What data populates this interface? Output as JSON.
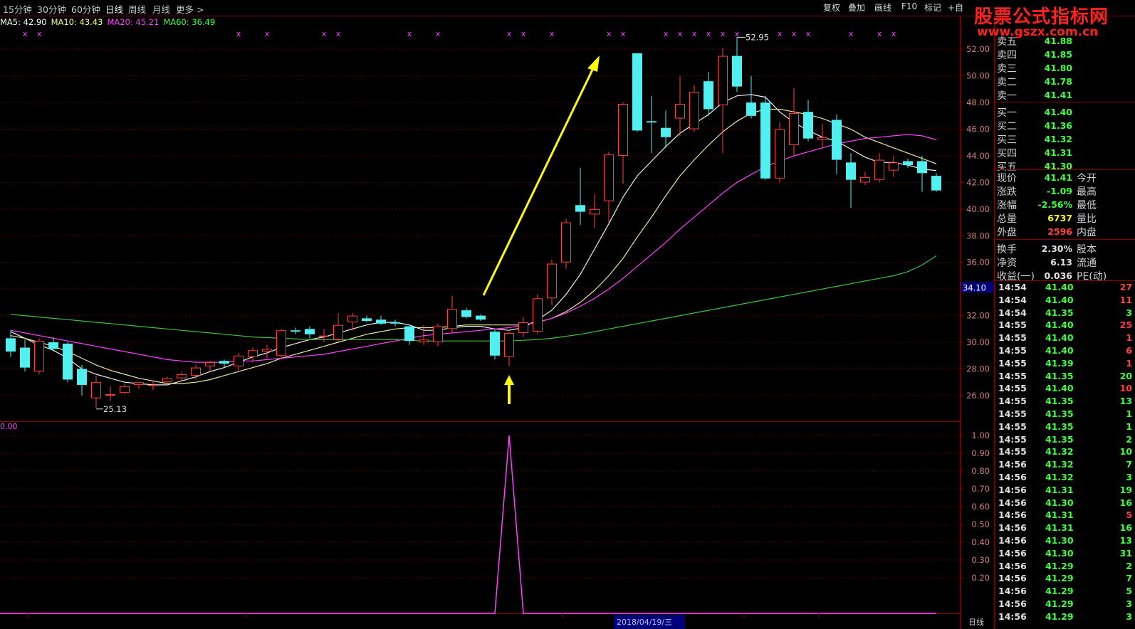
{
  "toolbar": {
    "periods": [
      "15分钟",
      "30分钟",
      "60分钟",
      "日线",
      "周线",
      "月线",
      "更多 >"
    ],
    "active_period": "日线",
    "buttons": [
      "复权",
      "叠加",
      "画线",
      "F10",
      "标记",
      "+自"
    ]
  },
  "watermark": {
    "line1": "股票公式指标网",
    "line2": "www.gszx.com.cn"
  },
  "ma_legend": [
    {
      "label": "MA5: 42.90",
      "color": "#ffffff"
    },
    {
      "label": "MA10: 43.43",
      "color": "#ffff80"
    },
    {
      "label": "MA20: 45.21",
      "color": "#ff40ff"
    },
    {
      "label": "MA60: 36.49",
      "color": "#40ff40"
    }
  ],
  "colors": {
    "up": "#ff4040",
    "down": "#50f0f0",
    "grid": "#8b0000",
    "axis_text": "#d08080",
    "green": "#40ff40",
    "red": "#ff4040",
    "yellow": "#ffff00"
  },
  "annotations": {
    "high_label": "52.95",
    "low_label": "25.13",
    "current_tag": "34.10",
    "indicator_top": "0.00",
    "date_label": "2018/04/19/三",
    "period_label": "日线"
  },
  "price_axis": {
    "ticks": [
      "52.00",
      "50.00",
      "48.00",
      "46.00",
      "44.00",
      "42.00",
      "40.00",
      "38.00",
      "36.00",
      "34.00",
      "32.00",
      "30.00",
      "28.00",
      "26.00"
    ]
  },
  "indicator_axis": {
    "ticks": [
      "1.00",
      "0.90",
      "0.80",
      "0.70",
      "0.60",
      "0.50",
      "0.40",
      "0.30",
      "0.20"
    ]
  },
  "order_book": {
    "sells": [
      {
        "label": "卖五",
        "price": "41.88"
      },
      {
        "label": "卖四",
        "price": "41.85"
      },
      {
        "label": "卖三",
        "price": "41.80"
      },
      {
        "label": "卖二",
        "price": "41.78"
      },
      {
        "label": "卖一",
        "price": "41.41"
      }
    ],
    "buys": [
      {
        "label": "买一",
        "price": "41.40"
      },
      {
        "label": "买二",
        "price": "41.36"
      },
      {
        "label": "买三",
        "price": "41.32"
      },
      {
        "label": "买四",
        "price": "41.31"
      },
      {
        "label": "买五",
        "price": "41.30"
      }
    ]
  },
  "quote": [
    {
      "label": "现价",
      "value": "41.41",
      "value_color": "#40ff40",
      "label2": "今开"
    },
    {
      "label": "涨跌",
      "value": "-1.09",
      "value_color": "#40ff40",
      "label2": "最高"
    },
    {
      "label": "涨幅",
      "value": "-2.56%",
      "value_color": "#40ff40",
      "label2": "最低"
    },
    {
      "label": "总量",
      "value": "6737",
      "value_color": "#ffff00",
      "label2": "量比"
    },
    {
      "label": "外盘",
      "value": "2596",
      "value_color": "#ff4040",
      "label2": "内盘"
    },
    {
      "label": "换手",
      "value": "2.30%",
      "value_color": "#e0e0e0",
      "label2": "股本"
    },
    {
      "label": "净资",
      "value": "6.13",
      "value_color": "#e0e0e0",
      "label2": "流通"
    },
    {
      "label": "收益(一)",
      "value": "0.036",
      "value_color": "#e0e0e0",
      "label2": "PE(动)"
    }
  ],
  "ticks": [
    {
      "time": "14:54",
      "price": "41.40",
      "vol": "27",
      "vcolor": "#ff4040"
    },
    {
      "time": "14:54",
      "price": "41.40",
      "vol": "11",
      "vcolor": "#ff4040"
    },
    {
      "time": "14:54",
      "price": "41.35",
      "vol": "3",
      "vcolor": "#40ff40"
    },
    {
      "time": "14:55",
      "price": "41.40",
      "vol": "25",
      "vcolor": "#ff4040"
    },
    {
      "time": "14:55",
      "price": "41.40",
      "vol": "1",
      "vcolor": "#ff4040"
    },
    {
      "time": "14:55",
      "price": "41.40",
      "vol": "6",
      "vcolor": "#ff4040"
    },
    {
      "time": "14:55",
      "price": "41.39",
      "vol": "1",
      "vcolor": "#ff4040"
    },
    {
      "time": "14:55",
      "price": "41.35",
      "vol": "20",
      "vcolor": "#40ff40"
    },
    {
      "time": "14:55",
      "price": "41.40",
      "vol": "10",
      "vcolor": "#ff4040"
    },
    {
      "time": "14:55",
      "price": "41.35",
      "vol": "13",
      "vcolor": "#40ff40"
    },
    {
      "time": "14:55",
      "price": "41.35",
      "vol": "1",
      "vcolor": "#40ff40"
    },
    {
      "time": "14:55",
      "price": "41.35",
      "vol": "1",
      "vcolor": "#40ff40"
    },
    {
      "time": "14:55",
      "price": "41.35",
      "vol": "2",
      "vcolor": "#40ff40"
    },
    {
      "time": "14:55",
      "price": "41.32",
      "vol": "10",
      "vcolor": "#40ff40"
    },
    {
      "time": "14:56",
      "price": "41.32",
      "vol": "7",
      "vcolor": "#40ff40"
    },
    {
      "time": "14:56",
      "price": "41.32",
      "vol": "3",
      "vcolor": "#40ff40"
    },
    {
      "time": "14:56",
      "price": "41.31",
      "vol": "19",
      "vcolor": "#40ff40"
    },
    {
      "time": "14:56",
      "price": "41.30",
      "vol": "16",
      "vcolor": "#40ff40"
    },
    {
      "time": "14:56",
      "price": "41.31",
      "vol": "5",
      "vcolor": "#ff4040"
    },
    {
      "time": "14:56",
      "price": "41.31",
      "vol": "16",
      "vcolor": "#40ff40"
    },
    {
      "time": "14:56",
      "price": "41.30",
      "vol": "13",
      "vcolor": "#40ff40"
    },
    {
      "time": "14:56",
      "price": "41.30",
      "vol": "31",
      "vcolor": "#40ff40"
    },
    {
      "time": "14:56",
      "price": "41.29",
      "vol": "2",
      "vcolor": "#40ff40"
    },
    {
      "time": "14:56",
      "price": "41.29",
      "vol": "7",
      "vcolor": "#40ff40"
    },
    {
      "time": "14:56",
      "price": "41.29",
      "vol": "5",
      "vcolor": "#40ff40"
    },
    {
      "time": "14:56",
      "price": "41.29",
      "vol": "3",
      "vcolor": "#40ff40"
    },
    {
      "time": "14:56",
      "price": "41.29",
      "vol": "3",
      "vcolor": "#40ff40"
    }
  ],
  "chart_data": {
    "type": "candlestick",
    "price_range": [
      24.5,
      52.6
    ],
    "candles": [
      {
        "o": 30.3,
        "h": 30.9,
        "l": 28.9,
        "c": 29.3
      },
      {
        "o": 29.6,
        "h": 30.2,
        "l": 27.8,
        "c": 28.1
      },
      {
        "o": 27.8,
        "h": 30.3,
        "l": 27.6,
        "c": 30.1
      },
      {
        "o": 30.0,
        "h": 30.4,
        "l": 29.3,
        "c": 29.5
      },
      {
        "o": 29.9,
        "h": 30.0,
        "l": 27.0,
        "c": 27.2
      },
      {
        "o": 28.0,
        "h": 28.3,
        "l": 26.0,
        "c": 26.8
      },
      {
        "o": 25.8,
        "h": 27.5,
        "l": 25.1,
        "c": 27.0
      },
      {
        "o": 26.0,
        "h": 26.7,
        "l": 25.6,
        "c": 26.1
      },
      {
        "o": 26.2,
        "h": 26.9,
        "l": 26.1,
        "c": 26.7
      },
      {
        "o": 26.8,
        "h": 27.0,
        "l": 26.5,
        "c": 27.0
      },
      {
        "o": 26.8,
        "h": 27.1,
        "l": 26.4,
        "c": 26.8
      },
      {
        "o": 27.0,
        "h": 27.4,
        "l": 26.8,
        "c": 27.3
      },
      {
        "o": 27.3,
        "h": 27.8,
        "l": 27.1,
        "c": 27.6
      },
      {
        "o": 27.5,
        "h": 28.3,
        "l": 27.2,
        "c": 28.1
      },
      {
        "o": 28.2,
        "h": 28.6,
        "l": 27.8,
        "c": 28.5
      },
      {
        "o": 28.6,
        "h": 28.7,
        "l": 28.1,
        "c": 28.4
      },
      {
        "o": 28.2,
        "h": 29.2,
        "l": 27.9,
        "c": 29.0
      },
      {
        "o": 28.9,
        "h": 29.6,
        "l": 28.5,
        "c": 29.4
      },
      {
        "o": 29.3,
        "h": 29.8,
        "l": 28.8,
        "c": 29.5
      },
      {
        "o": 29.0,
        "h": 31.0,
        "l": 28.8,
        "c": 30.9
      },
      {
        "o": 30.9,
        "h": 31.1,
        "l": 30.6,
        "c": 30.8
      },
      {
        "o": 31.0,
        "h": 31.2,
        "l": 30.3,
        "c": 30.6
      },
      {
        "o": 30.4,
        "h": 31.0,
        "l": 30.0,
        "c": 30.5
      },
      {
        "o": 30.2,
        "h": 32.2,
        "l": 30.0,
        "c": 31.3
      },
      {
        "o": 31.5,
        "h": 32.2,
        "l": 30.9,
        "c": 32.0
      },
      {
        "o": 31.8,
        "h": 32.0,
        "l": 31.5,
        "c": 31.6
      },
      {
        "o": 31.7,
        "h": 32.0,
        "l": 31.3,
        "c": 31.4
      },
      {
        "o": 31.5,
        "h": 31.7,
        "l": 31.2,
        "c": 31.4
      },
      {
        "o": 31.2,
        "h": 31.3,
        "l": 29.8,
        "c": 30.1
      },
      {
        "o": 30.0,
        "h": 31.3,
        "l": 29.8,
        "c": 30.2
      },
      {
        "o": 30.0,
        "h": 31.4,
        "l": 29.7,
        "c": 31.2
      },
      {
        "o": 31.0,
        "h": 33.5,
        "l": 30.7,
        "c": 32.5
      },
      {
        "o": 32.4,
        "h": 32.6,
        "l": 31.8,
        "c": 31.9
      },
      {
        "o": 32.0,
        "h": 32.1,
        "l": 31.6,
        "c": 31.7
      },
      {
        "o": 30.8,
        "h": 31.0,
        "l": 28.7,
        "c": 29.0
      },
      {
        "o": 28.9,
        "h": 30.8,
        "l": 28.2,
        "c": 30.7
      },
      {
        "o": 30.7,
        "h": 31.9,
        "l": 30.4,
        "c": 31.5
      },
      {
        "o": 30.8,
        "h": 33.6,
        "l": 30.6,
        "c": 33.3
      },
      {
        "o": 33.3,
        "h": 36.2,
        "l": 32.8,
        "c": 35.9
      },
      {
        "o": 36.0,
        "h": 39.3,
        "l": 35.5,
        "c": 39.0
      },
      {
        "o": 40.3,
        "h": 43.1,
        "l": 38.8,
        "c": 39.8
      },
      {
        "o": 39.6,
        "h": 41.1,
        "l": 38.6,
        "c": 40.0
      },
      {
        "o": 40.6,
        "h": 44.3,
        "l": 39.0,
        "c": 44.1
      },
      {
        "o": 44.0,
        "h": 48.0,
        "l": 41.9,
        "c": 47.9
      },
      {
        "o": 51.7,
        "h": 51.7,
        "l": 45.8,
        "c": 45.9
      },
      {
        "o": 46.6,
        "h": 48.5,
        "l": 44.2,
        "c": 46.5
      },
      {
        "o": 46.1,
        "h": 47.4,
        "l": 44.6,
        "c": 45.4
      },
      {
        "o": 46.8,
        "h": 50.0,
        "l": 45.5,
        "c": 47.9
      },
      {
        "o": 46.0,
        "h": 49.3,
        "l": 45.8,
        "c": 48.8
      },
      {
        "o": 49.6,
        "h": 50.3,
        "l": 47.0,
        "c": 47.5
      },
      {
        "o": 47.8,
        "h": 52.1,
        "l": 44.2,
        "c": 51.5
      },
      {
        "o": 51.5,
        "h": 52.9,
        "l": 48.8,
        "c": 49.2
      },
      {
        "o": 48.0,
        "h": 50.0,
        "l": 46.8,
        "c": 47.0
      },
      {
        "o": 48.0,
        "h": 48.5,
        "l": 42.2,
        "c": 42.3
      },
      {
        "o": 42.3,
        "h": 46.5,
        "l": 42.0,
        "c": 46.0
      },
      {
        "o": 44.8,
        "h": 49.1,
        "l": 44.0,
        "c": 47.2
      },
      {
        "o": 47.3,
        "h": 48.2,
        "l": 45.1,
        "c": 45.3
      },
      {
        "o": 45.2,
        "h": 46.4,
        "l": 44.6,
        "c": 45.4
      },
      {
        "o": 46.7,
        "h": 47.1,
        "l": 42.6,
        "c": 43.7
      },
      {
        "o": 43.5,
        "h": 44.2,
        "l": 40.1,
        "c": 42.2
      },
      {
        "o": 42.0,
        "h": 42.8,
        "l": 41.8,
        "c": 42.4
      },
      {
        "o": 42.2,
        "h": 44.2,
        "l": 42.0,
        "c": 43.7
      },
      {
        "o": 42.9,
        "h": 44.0,
        "l": 42.4,
        "c": 43.5
      },
      {
        "o": 43.6,
        "h": 43.8,
        "l": 43.1,
        "c": 43.3
      },
      {
        "o": 43.6,
        "h": 44.0,
        "l": 41.3,
        "c": 42.7
      },
      {
        "o": 42.5,
        "h": 42.7,
        "l": 41.3,
        "c": 41.4
      }
    ],
    "ma_lines": [
      {
        "name": "MA5",
        "color": "#f0f0f0",
        "values": [
          30.8,
          30.3,
          29.8,
          29.4,
          28.8,
          28.0,
          27.6,
          27.3,
          27.0,
          26.9,
          26.8,
          26.8,
          27.1,
          27.4,
          27.8,
          28.1,
          28.5,
          28.9,
          29.2,
          29.6,
          29.9,
          30.2,
          30.4,
          30.7,
          31.0,
          31.3,
          31.5,
          31.5,
          31.3,
          30.9,
          30.9,
          31.1,
          31.2,
          31.2,
          31.0,
          30.9,
          31.1,
          31.7,
          32.4,
          33.6,
          35.1,
          37.0,
          38.9,
          40.9,
          42.5,
          43.6,
          44.7,
          45.7,
          46.4,
          47.1,
          48.0,
          48.5,
          48.6,
          48.4,
          47.3,
          46.5,
          45.9,
          45.4,
          45.1,
          44.5,
          43.9,
          43.5,
          43.5,
          43.3,
          43.0,
          42.9
        ]
      },
      {
        "name": "MA10",
        "color": "#e8e8a0",
        "values": [
          30.5,
          30.3,
          30.0,
          29.7,
          29.3,
          28.8,
          28.3,
          27.9,
          27.6,
          27.3,
          27.1,
          26.9,
          26.9,
          27.0,
          27.2,
          27.5,
          27.8,
          28.1,
          28.4,
          28.8,
          29.1,
          29.4,
          29.7,
          30.0,
          30.3,
          30.6,
          30.8,
          31.0,
          31.1,
          31.1,
          31.1,
          31.2,
          31.3,
          31.3,
          31.3,
          31.3,
          31.3,
          31.5,
          31.8,
          32.3,
          33.0,
          33.9,
          35.0,
          36.3,
          37.9,
          39.4,
          41.0,
          42.5,
          43.7,
          44.8,
          45.8,
          46.6,
          47.2,
          47.5,
          47.5,
          47.3,
          47.1,
          46.8,
          46.4,
          46.0,
          45.4,
          45.0,
          44.6,
          44.2,
          43.8,
          43.4
        ]
      },
      {
        "name": "MA20",
        "color": "#ff40ff",
        "values": [
          30.9,
          30.7,
          30.5,
          30.3,
          30.1,
          29.9,
          29.7,
          29.5,
          29.3,
          29.1,
          28.9,
          28.7,
          28.6,
          28.5,
          28.5,
          28.5,
          28.6,
          28.6,
          28.7,
          28.8,
          28.9,
          29.0,
          29.1,
          29.3,
          29.5,
          29.7,
          29.9,
          30.1,
          30.3,
          30.5,
          30.6,
          30.7,
          30.8,
          30.9,
          31.0,
          31.1,
          31.3,
          31.5,
          31.8,
          32.2,
          32.7,
          33.3,
          34.0,
          34.8,
          35.7,
          36.6,
          37.5,
          38.5,
          39.4,
          40.3,
          41.2,
          42.0,
          42.6,
          43.2,
          43.6,
          44.0,
          44.3,
          44.6,
          44.9,
          45.1,
          45.3,
          45.4,
          45.5,
          45.6,
          45.5,
          45.2
        ]
      },
      {
        "name": "MA60",
        "color": "#40c040",
        "values": [
          32.1,
          32.0,
          31.9,
          31.8,
          31.7,
          31.6,
          31.5,
          31.4,
          31.3,
          31.2,
          31.1,
          31.0,
          30.9,
          30.8,
          30.7,
          30.6,
          30.5,
          30.4,
          30.35,
          30.3,
          30.25,
          30.2,
          30.2,
          30.2,
          30.2,
          30.2,
          30.2,
          30.2,
          30.15,
          30.1,
          30.1,
          30.1,
          30.1,
          30.1,
          30.1,
          30.1,
          30.15,
          30.2,
          30.3,
          30.45,
          30.6,
          30.8,
          31.0,
          31.2,
          31.4,
          31.6,
          31.8,
          32.0,
          32.2,
          32.4,
          32.6,
          32.8,
          33.0,
          33.2,
          33.4,
          33.6,
          33.8,
          34.0,
          34.2,
          34.4,
          34.6,
          34.8,
          35.0,
          35.3,
          35.8,
          36.5
        ]
      }
    ],
    "signal_markers": [
      1,
      2,
      16,
      18,
      22,
      23,
      28,
      30,
      35,
      36,
      38,
      42,
      43,
      46,
      47,
      48,
      49,
      50,
      51,
      54,
      55,
      56,
      59,
      61,
      62
    ],
    "indicator": {
      "name": "signal",
      "values": [
        0,
        0,
        0,
        0,
        0,
        0,
        0,
        0,
        0,
        0,
        0,
        0,
        0,
        0,
        0,
        0,
        0,
        0,
        0,
        0,
        0,
        0,
        0,
        0,
        0,
        0,
        0,
        0,
        0,
        0,
        0,
        0,
        0,
        0,
        0,
        1,
        0,
        0,
        0,
        0,
        0,
        0,
        0,
        0,
        0,
        0,
        0,
        0,
        0,
        0,
        0,
        0,
        0,
        0,
        0,
        0,
        0,
        0,
        0,
        0,
        0,
        0,
        0,
        0,
        0,
        0
      ],
      "range": [
        0,
        1
      ]
    }
  }
}
